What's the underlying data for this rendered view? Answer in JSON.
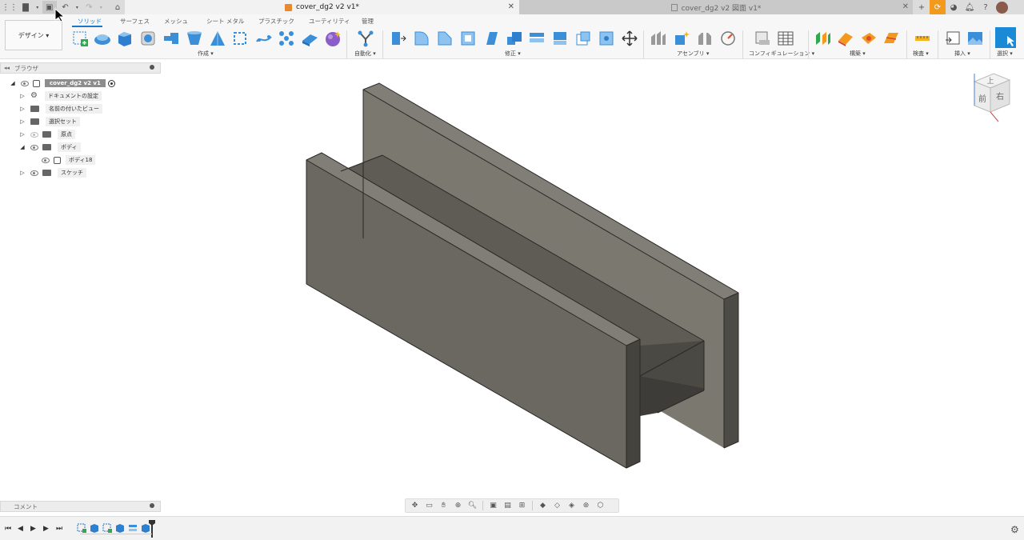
{
  "tabs": {
    "active_title": "cover_dg2 v2 v1*",
    "inactive_title": "cover_dg2 v2 図面 v1*"
  },
  "toolbar": {
    "workspace_label": "デザイン ▾",
    "workspace_tabs": [
      "ソリッド",
      "サーフェス",
      "メッシュ",
      "シート メタル",
      "プラスチック",
      "ユーティリティ",
      "管理"
    ],
    "groups": {
      "create": "作成 ▾",
      "automate": "自動化 ▾",
      "modify": "修正 ▾",
      "assemble": "アセンブリ ▾",
      "configure": "コンフィギュレーション ▾",
      "construct": "構築 ▾",
      "inspect": "検査 ▾",
      "insert": "挿入 ▾",
      "select": "選択 ▾"
    }
  },
  "browser": {
    "header": "ブラウザ",
    "root": "cover_dg2 v2 v1",
    "items": [
      {
        "label": "ドキュメントの設定"
      },
      {
        "label": "名前の付いたビュー"
      },
      {
        "label": "選択セット"
      },
      {
        "label": "原点"
      },
      {
        "label": "ボディ"
      },
      {
        "label": "ボディ18"
      },
      {
        "label": "スケッチ"
      }
    ]
  },
  "comments": {
    "header": "コメント"
  },
  "viewcube": {
    "top": "上",
    "front": "前",
    "right": "右"
  },
  "colors": {
    "accent": "#1b76c8",
    "tab_active_bg": "#f2f2f2",
    "title_bar": "#dcdcdc",
    "model_face_front": "#68665f",
    "model_face_top": "#6e6c64",
    "model_face_dark": "#4a4843",
    "orange_button": "#f39a1e"
  }
}
